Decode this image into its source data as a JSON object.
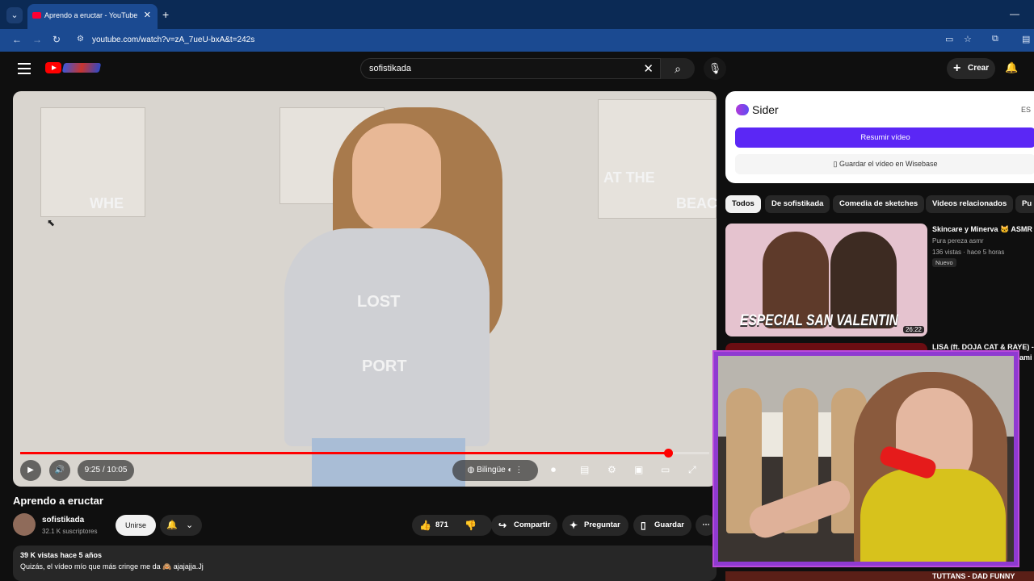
{
  "browser": {
    "tab_title": "Aprendo a eructar - YouTube",
    "url": "youtube.com/watch?v=zA_7ueU-bxA&t=242s"
  },
  "youtube": {
    "search_query": "sofistikada",
    "create_label": "Crear"
  },
  "player": {
    "time_display": "9:25 / 10:05",
    "progress_fraction": 0.94,
    "bilingual_label": "Bilingüe",
    "frame_text_left": "WHE",
    "frame_text_right_1": "AT THE",
    "frame_text_right_2": "BEACH",
    "shirt_text_1": "LOST",
    "shirt_text_2": "PORT"
  },
  "video": {
    "title": "Aprendo a eructar",
    "channel_name": "sofistikada",
    "subscribers": "32.1 K suscriptores",
    "join_label": "Unirse",
    "likes": "871",
    "share_label": "Compartir",
    "ask_label": "Preguntar",
    "save_label": "Guardar",
    "views_meta": "39 K vistas  hace 5 años",
    "description": "Quizás, el vídeo mío que más cringe me da 🙈 ajajajja.Jj"
  },
  "sider": {
    "name": "Sider",
    "lang": "ES",
    "summarize_label": "Resumir vídeo",
    "save_label": "Guardar el vídeo en Wisebase"
  },
  "chips": [
    "Todos",
    "De sofistikada",
    "Comedia de sketches",
    "Videos relacionados",
    "Pu"
  ],
  "recommendations": [
    {
      "title": "Skincare y Minerva 🐱 ASMR",
      "channel": "Pura pereza asmr",
      "meta": "136 vistas · hace 5 horas",
      "badge": "Nuevo",
      "thumb_text": "ESPECIAL SAN VALENTIN",
      "duration": "26:22"
    },
    {
      "title": "LISA (ft. DOJA CAT & RAYE) -",
      "line2": "ami ..."
    }
  ],
  "bottom_peek_text": "TUTTANS - DAD FUNNY"
}
